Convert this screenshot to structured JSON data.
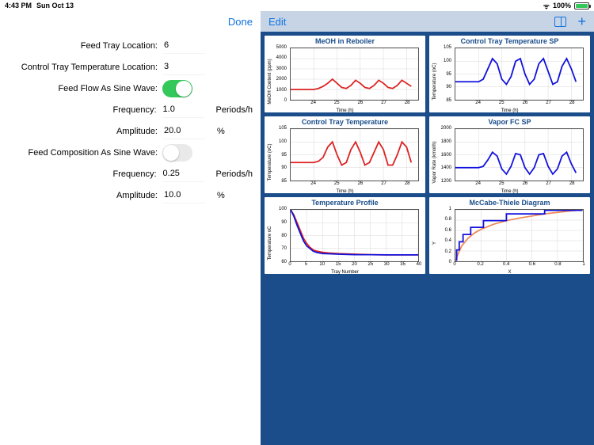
{
  "status": {
    "time": "4:43 PM",
    "date": "Sun Oct 13",
    "battery": "100%",
    "wifi_icon": "wifi-icon"
  },
  "left": {
    "done": "Done",
    "rows": [
      {
        "label": "Feed Tray Location:",
        "value": "6",
        "kind": "num"
      },
      {
        "label": "Control Tray Temperature Location:",
        "value": "3",
        "kind": "num"
      },
      {
        "label": "Feed Flow As Sine Wave:",
        "value": true,
        "kind": "toggle"
      },
      {
        "label": "Frequency:",
        "value": "1.0",
        "kind": "num",
        "unit": "Periods/h"
      },
      {
        "label": "Amplitude:",
        "value": "20.0",
        "kind": "num",
        "unit": "%"
      },
      {
        "label": "Feed Composition As Sine Wave:",
        "value": false,
        "kind": "toggle"
      },
      {
        "label": "Frequency:",
        "value": "0.25",
        "kind": "num",
        "unit": "Periods/h"
      },
      {
        "label": "Amplitude:",
        "value": "10.0",
        "kind": "num",
        "unit": "%"
      }
    ]
  },
  "right": {
    "edit": "Edit"
  },
  "chart_data": [
    {
      "type": "line",
      "title": "MeOH in Reboiler",
      "xlabel": "Time (h)",
      "ylabel": "MeOH Content (ppm)",
      "x": [
        23,
        23.2,
        23.4,
        23.6,
        23.8,
        24,
        24.2,
        24.4,
        24.6,
        24.8,
        25,
        25.2,
        25.4,
        25.6,
        25.8,
        26,
        26.2,
        26.4,
        26.6,
        26.8,
        27,
        27.2,
        27.4,
        27.6,
        27.8,
        28,
        28.2
      ],
      "series": [
        {
          "name": "meoh",
          "color": "#d22",
          "values": [
            1000,
            1000,
            1000,
            1000,
            1000,
            1000,
            1100,
            1300,
            1600,
            2000,
            1600,
            1200,
            1100,
            1400,
            1900,
            1600,
            1200,
            1100,
            1400,
            1900,
            1600,
            1200,
            1100,
            1400,
            1900,
            1600,
            1300
          ]
        }
      ],
      "xlim": [
        23,
        28.5
      ],
      "ylim": [
        0,
        5000
      ],
      "yticks": [
        0,
        1000,
        2000,
        3000,
        4000,
        5000
      ],
      "xticks": [
        24,
        25,
        26,
        27,
        28
      ]
    },
    {
      "type": "line",
      "title": "Control Tray Temperature SP",
      "xlabel": "Time (h)",
      "ylabel": "Temperature (oC)",
      "x": [
        23,
        23.2,
        23.4,
        23.6,
        23.8,
        24,
        24.2,
        24.4,
        24.6,
        24.8,
        25,
        25.2,
        25.4,
        25.6,
        25.8,
        26,
        26.2,
        26.4,
        26.6,
        26.8,
        27,
        27.2,
        27.4,
        27.6,
        27.8,
        28,
        28.2
      ],
      "series": [
        {
          "name": "sp",
          "color": "#11d",
          "values": [
            92,
            92,
            92,
            92,
            92,
            92,
            93,
            97,
            101,
            99,
            93,
            91,
            94,
            100,
            101,
            95,
            91,
            93,
            99,
            101,
            96,
            91,
            92,
            98,
            101,
            97,
            92
          ]
        }
      ],
      "xlim": [
        23,
        28.5
      ],
      "ylim": [
        85,
        105
      ],
      "yticks": [
        85,
        90,
        95,
        100,
        105
      ],
      "xticks": [
        24,
        25,
        26,
        27,
        28
      ]
    },
    {
      "type": "line",
      "title": "Control Tray Temperature",
      "xlabel": "Time (h)",
      "ylabel": "Temperature (oC)",
      "x": [
        23,
        23.2,
        23.4,
        23.6,
        23.8,
        24,
        24.2,
        24.4,
        24.6,
        24.8,
        25,
        25.2,
        25.4,
        25.6,
        25.8,
        26,
        26.2,
        26.4,
        26.6,
        26.8,
        27,
        27.2,
        27.4,
        27.6,
        27.8,
        28,
        28.2
      ],
      "series": [
        {
          "name": "t",
          "color": "#d22",
          "values": [
            92,
            92,
            92,
            92,
            92,
            92,
            92.5,
            94,
            98,
            100,
            95,
            91,
            92,
            97,
            100,
            96,
            91,
            92,
            96,
            100,
            97,
            91,
            91,
            95,
            100,
            98,
            92
          ]
        }
      ],
      "xlim": [
        23,
        28.5
      ],
      "ylim": [
        85,
        105
      ],
      "yticks": [
        85,
        90,
        95,
        100,
        105
      ],
      "xticks": [
        24,
        25,
        26,
        27,
        28
      ]
    },
    {
      "type": "line",
      "title": "Vapor FC SP",
      "xlabel": "Time (h)",
      "ylabel": "Vapor Rate (kmol/h)",
      "x": [
        23,
        23.2,
        23.4,
        23.6,
        23.8,
        24,
        24.2,
        24.4,
        24.6,
        24.8,
        25,
        25.2,
        25.4,
        25.6,
        25.8,
        26,
        26.2,
        26.4,
        26.6,
        26.8,
        27,
        27.2,
        27.4,
        27.6,
        27.8,
        28,
        28.2
      ],
      "series": [
        {
          "name": "v",
          "color": "#11d",
          "values": [
            1400,
            1400,
            1400,
            1400,
            1400,
            1400,
            1420,
            1520,
            1640,
            1580,
            1380,
            1300,
            1420,
            1620,
            1600,
            1400,
            1300,
            1400,
            1600,
            1620,
            1420,
            1300,
            1380,
            1580,
            1640,
            1460,
            1320
          ]
        }
      ],
      "xlim": [
        23,
        28.5
      ],
      "ylim": [
        1200,
        2000
      ],
      "yticks": [
        1200,
        1400,
        1600,
        1800,
        2000
      ],
      "xticks": [
        24,
        25,
        26,
        27,
        28
      ]
    },
    {
      "type": "line",
      "title": "Temperature Profile",
      "xlabel": "Tray Number",
      "ylabel": "Temperature oC",
      "x": [
        0,
        1,
        2,
        3,
        4,
        5,
        6,
        7,
        8,
        10,
        12,
        15,
        20,
        25,
        30,
        35,
        40
      ],
      "series": [
        {
          "name": "p1",
          "color": "#d22",
          "values": [
            100,
            96,
            90,
            84,
            78,
            74,
            71,
            69,
            68,
            67,
            66.5,
            66,
            65.5,
            65.2,
            65,
            65,
            65
          ]
        },
        {
          "name": "p2",
          "color": "#11d",
          "values": [
            100,
            95,
            88,
            82,
            76,
            72,
            70,
            68,
            67,
            66,
            65.8,
            65.5,
            65.2,
            65.1,
            65,
            65,
            65
          ]
        }
      ],
      "xlim": [
        0,
        40
      ],
      "ylim": [
        60,
        100
      ],
      "yticks": [
        60,
        70,
        80,
        90,
        100
      ],
      "xticks": [
        0,
        5,
        10,
        15,
        20,
        25,
        30,
        35,
        40
      ]
    },
    {
      "type": "line",
      "title": "McCabe-Thiele Diagram",
      "xlabel": "X",
      "ylabel": "Y",
      "x_eq": [
        0,
        0.02,
        0.05,
        0.1,
        0.15,
        0.2,
        0.3,
        0.4,
        0.5,
        0.6,
        0.7,
        0.8,
        0.9,
        1.0
      ],
      "series": [
        {
          "name": "eq",
          "color": "#e85",
          "kind": "smooth",
          "x": [
            0,
            0.02,
            0.05,
            0.1,
            0.15,
            0.2,
            0.3,
            0.4,
            0.5,
            0.6,
            0.7,
            0.8,
            0.9,
            1.0
          ],
          "values": [
            0,
            0.14,
            0.3,
            0.45,
            0.55,
            0.62,
            0.72,
            0.79,
            0.84,
            0.88,
            0.92,
            0.95,
            0.98,
            1.0
          ]
        },
        {
          "name": "steps",
          "color": "#11d",
          "kind": "step",
          "x": [
            0.01,
            0.01,
            0.03,
            0.03,
            0.06,
            0.06,
            0.12,
            0.12,
            0.22,
            0.22,
            0.4,
            0.4,
            0.7,
            0.7,
            0.99,
            0.99
          ],
          "values": [
            0.01,
            0.22,
            0.22,
            0.38,
            0.38,
            0.52,
            0.52,
            0.66,
            0.66,
            0.79,
            0.79,
            0.92,
            0.92,
            0.99,
            0.99,
            1.0
          ]
        }
      ],
      "xlim": [
        0,
        1
      ],
      "ylim": [
        0,
        1
      ],
      "yticks": [
        0,
        0.2,
        0.4,
        0.6,
        0.8,
        1.0
      ],
      "xticks": [
        0,
        0.2,
        0.4,
        0.6,
        0.8,
        1.0
      ]
    }
  ]
}
